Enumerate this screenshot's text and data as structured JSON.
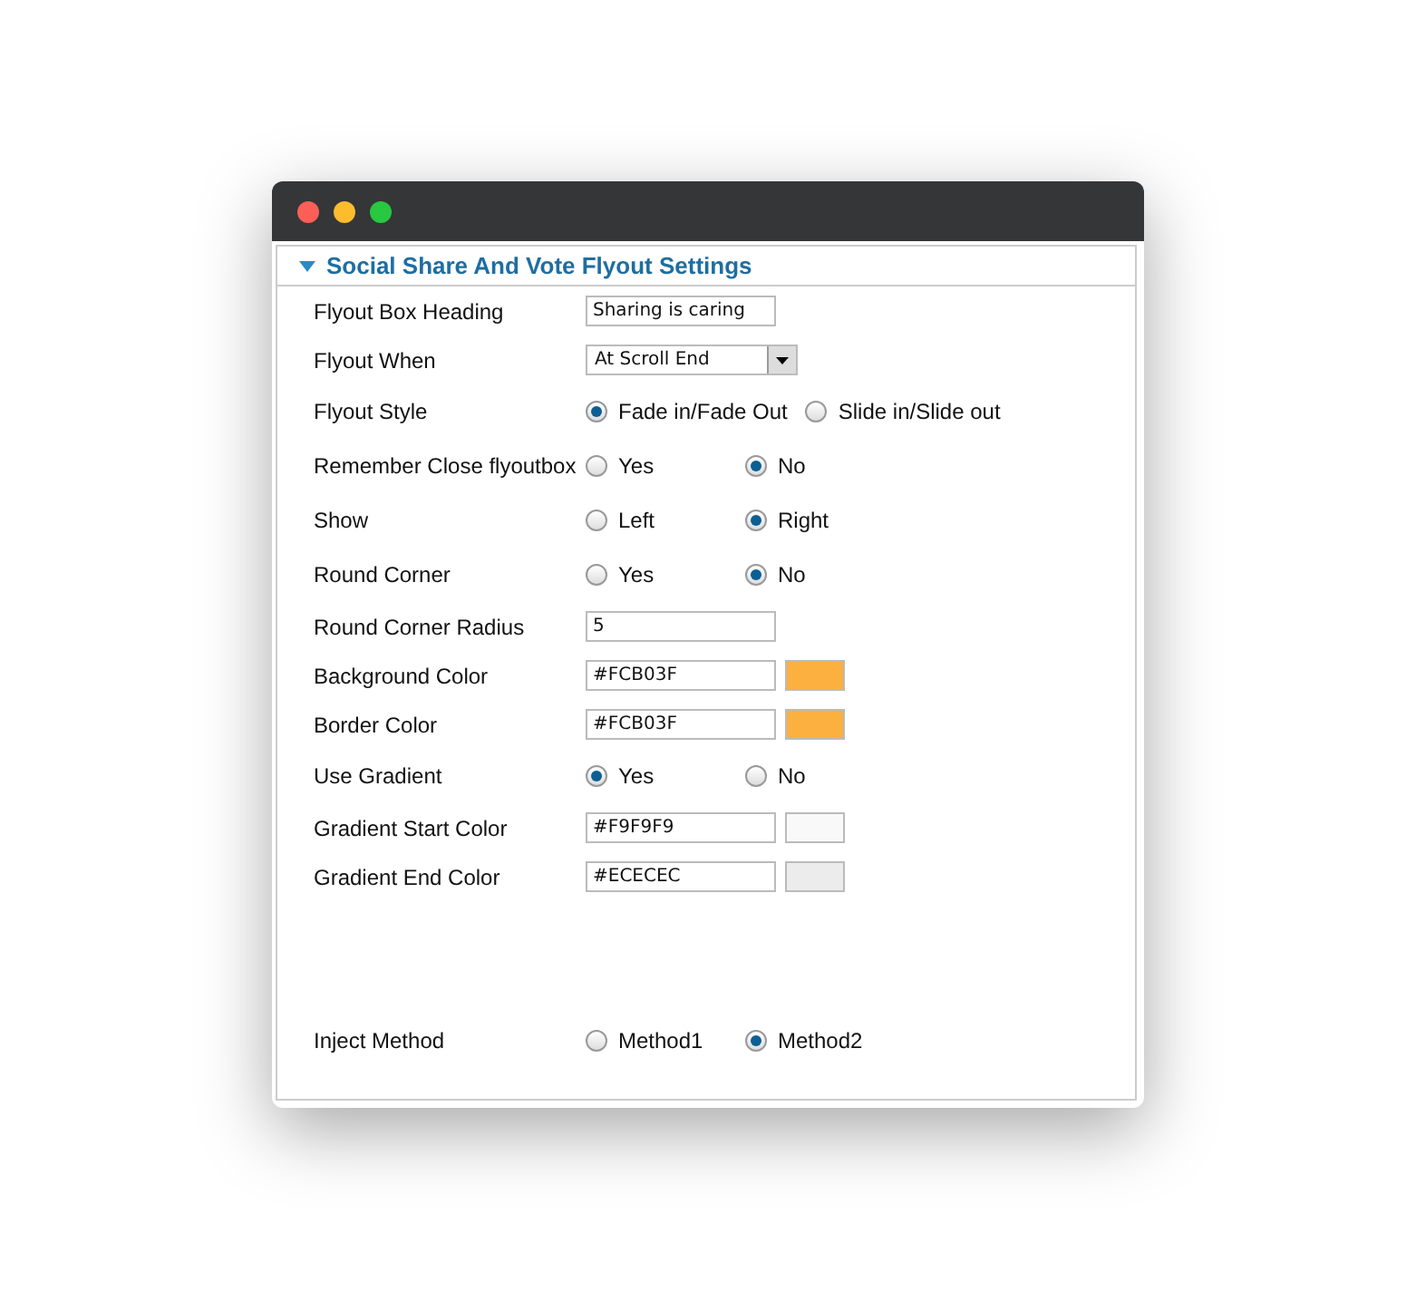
{
  "panel": {
    "title": "Social Share And Vote Flyout Settings",
    "expanded": true
  },
  "fields": [
    {
      "kind": "text",
      "label": "Flyout Box Heading",
      "value": "Sharing is caring"
    },
    {
      "kind": "select",
      "label": "Flyout When",
      "value": "At Scroll End"
    },
    {
      "kind": "radio",
      "label": "Flyout Style",
      "options": [
        {
          "label": "Fade in/Fade Out",
          "selected": true
        },
        {
          "label": "Slide in/Slide out",
          "selected": false
        }
      ]
    },
    {
      "kind": "radio",
      "label": "Remember Close flyoutbox",
      "options": [
        {
          "label": "Yes",
          "selected": false
        },
        {
          "label": "No",
          "selected": true
        }
      ]
    },
    {
      "kind": "radio",
      "label": "Show",
      "options": [
        {
          "label": "Left",
          "selected": false
        },
        {
          "label": "Right",
          "selected": true
        }
      ]
    },
    {
      "kind": "radio",
      "label": "Round Corner",
      "options": [
        {
          "label": "Yes",
          "selected": false
        },
        {
          "label": "No",
          "selected": true
        }
      ]
    },
    {
      "kind": "text",
      "label": "Round Corner Radius",
      "value": "5"
    },
    {
      "kind": "color",
      "label": "Background Color",
      "value": "#FCB03F",
      "color": "#fcb03f"
    },
    {
      "kind": "color",
      "label": "Border Color",
      "value": "#FCB03F",
      "color": "#fcb03f"
    },
    {
      "kind": "radio",
      "label": "Use Gradient",
      "options": [
        {
          "label": "Yes",
          "selected": true
        },
        {
          "label": "No",
          "selected": false
        }
      ]
    },
    {
      "kind": "color",
      "label": "Gradient Start Color",
      "value": "#F9F9F9",
      "color": "#f9f9f9"
    },
    {
      "kind": "color",
      "label": "Gradient End Color",
      "value": "#ECECEC",
      "color": "#ececec"
    },
    {
      "kind": "radio",
      "label": "Inject Method",
      "options": [
        {
          "label": "Method1",
          "selected": false
        },
        {
          "label": "Method2",
          "selected": true
        }
      ]
    }
  ]
}
